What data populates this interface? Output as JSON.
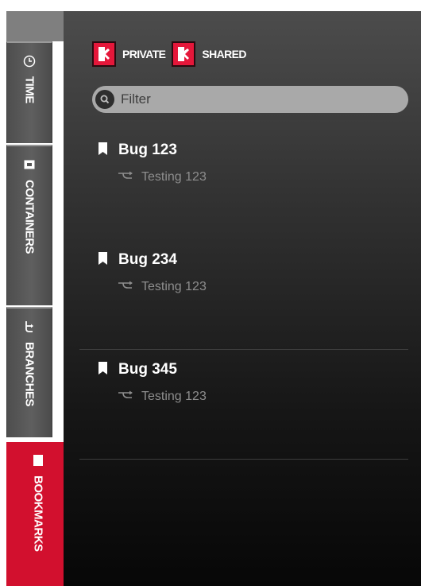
{
  "tabs": [
    {
      "label": "TIME",
      "icon": "clock-icon",
      "active": false
    },
    {
      "label": "CONTAINERS",
      "icon": "container-icon",
      "active": false
    },
    {
      "label": "BRANCHES",
      "icon": "branch-icon",
      "active": false
    },
    {
      "label": "BOOKMARKS",
      "icon": "bookmark-icon",
      "active": true
    }
  ],
  "toggles": {
    "private_label": "PRIVATE",
    "shared_label": "SHARED"
  },
  "filter": {
    "placeholder": "Filter",
    "value": ""
  },
  "bookmarks": [
    {
      "title": "Bug 123",
      "branch": "Testing 123"
    },
    {
      "title": "Bug 234",
      "branch": "Testing 123"
    },
    {
      "title": "Bug 345",
      "branch": "Testing 123"
    }
  ],
  "colors": {
    "accent": "#d2102e",
    "panel_top": "#4c4c4c",
    "panel_bottom": "#070707",
    "tab_bg": "#555555",
    "filter_bg": "#a9a9a9",
    "text_secondary": "#8e8e8e"
  }
}
